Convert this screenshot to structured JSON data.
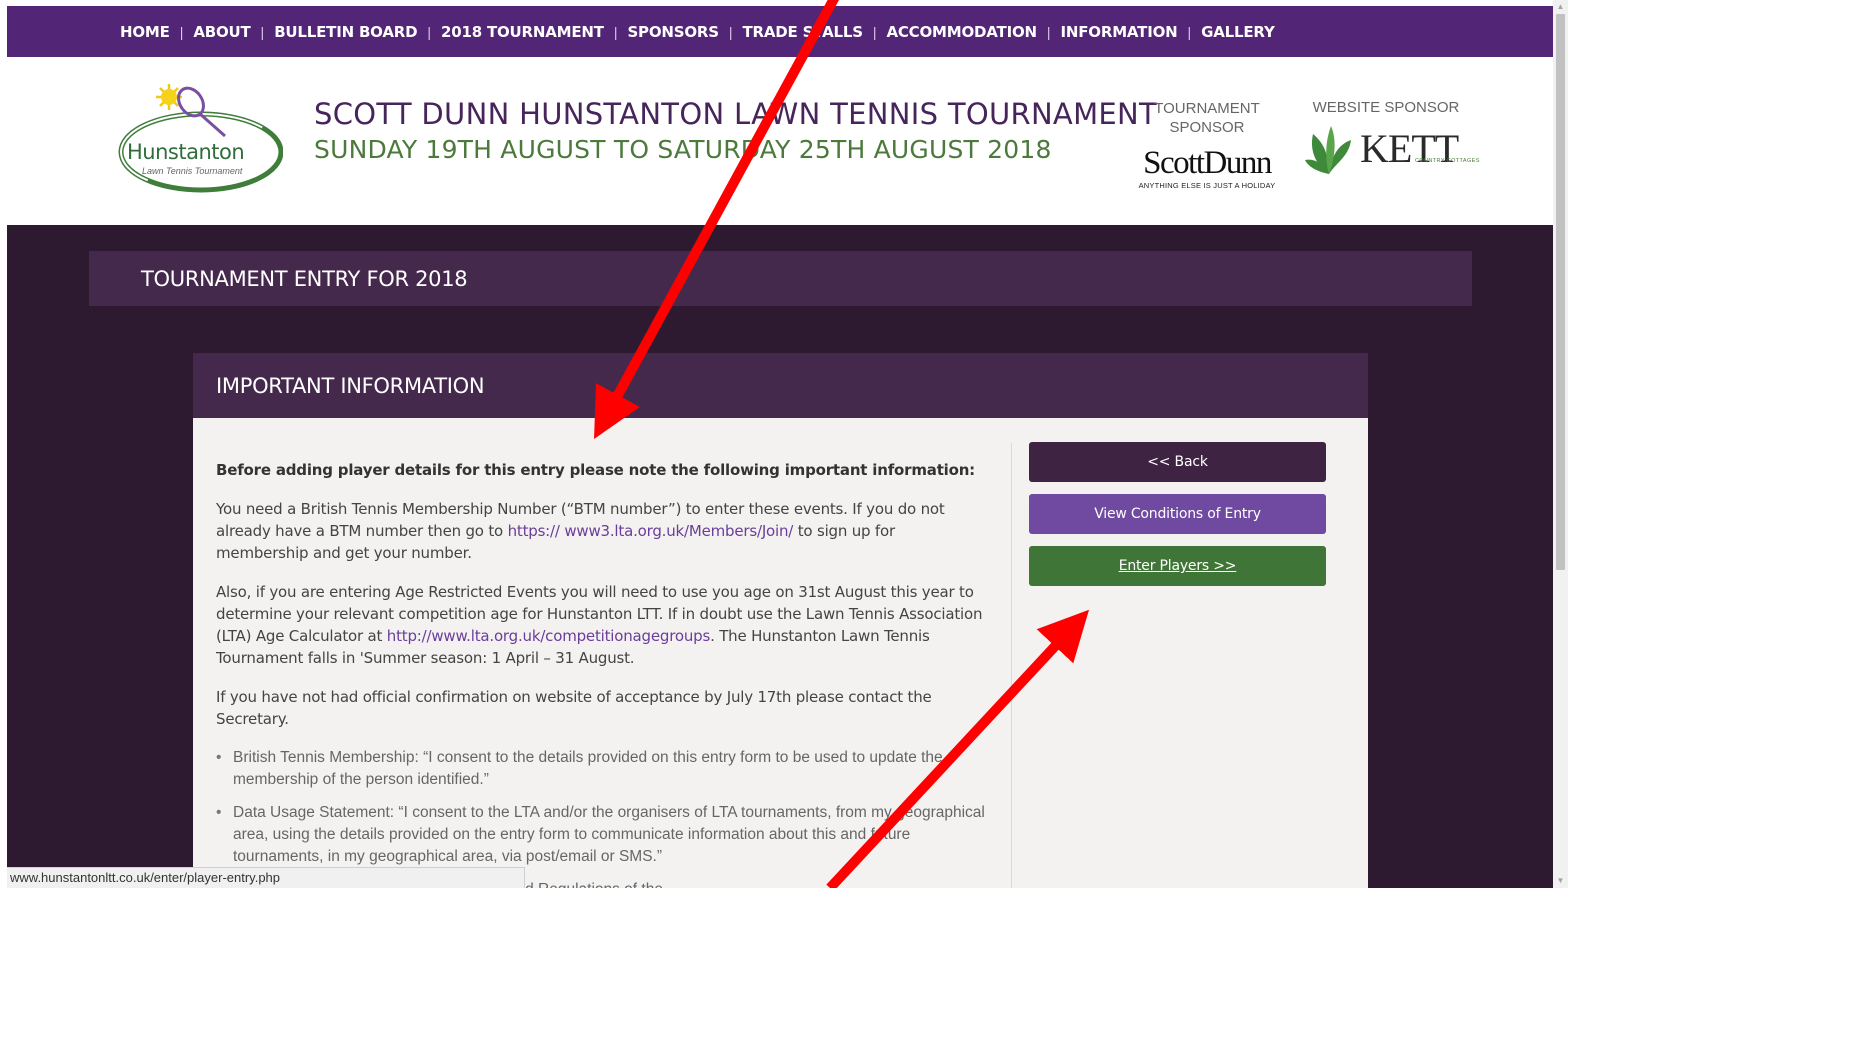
{
  "nav": {
    "items": [
      "HOME",
      "ABOUT",
      "BULLETIN BOARD",
      "2018 TOURNAMENT",
      "SPONSORS",
      "TRADE STALLS",
      "ACCOMMODATION",
      "INFORMATION",
      "GALLERY"
    ],
    "separator": "|"
  },
  "header": {
    "logo_word": "Hunstanton",
    "logo_sub": "Lawn Tennis Tournament",
    "title": "SCOTT DUNN HUNSTANTON LAWN TENNIS TOURNAMENT",
    "dates": "SUNDAY 19TH AUGUST TO SATURDAY 25TH AUGUST 2018",
    "tournament_sponsor_label": "TOURNAMENT SPONSOR",
    "tournament_sponsor_name": "ScottDunn",
    "tournament_sponsor_tagline": "ANYTHING ELSE IS JUST A HOLIDAY",
    "website_sponsor_label": "WEBSITE SPONSOR",
    "website_sponsor_name": "KETT",
    "website_sponsor_tagline": "COUNTRY COTTAGES"
  },
  "section": {
    "title": "TOURNAMENT ENTRY FOR 2018"
  },
  "panel": {
    "title": "IMPORTANT INFORMATION",
    "lead": "Before adding player details for this entry please note the following important information:",
    "p1_before": "You need a British Tennis Membership Number (“BTM number”) to enter these events. If you do not already have a BTM number then go to ",
    "p1_link": "https:// www3.lta.org.uk/Members/Join/",
    "p1_after": " to sign up for membership and get your number.",
    "p2_before": "Also, if you are entering Age Restricted Events you will need to use you age on 31st August this year to determine your relevant competition age for Hunstanton LTT. If in doubt use the Lawn Tennis Association (LTA) Age Calculator at ",
    "p2_link": "http://www.lta.org.uk/competitionagegroups",
    "p2_after": ". The Hunstanton Lawn Tennis Tournament falls in 'Summer season: 1 April – 31 August.",
    "p3": "If you have not had official confirmation on website of acceptance by July 17th please contact the Secretary.",
    "bullets": [
      "British Tennis Membership: “I consent to the details provided on this entry form to be used to update the membership of the person identified.”",
      "Data Usage Statement: “I consent to the LTA and/or the organisers of LTA tournaments, from my geographical area, using the details provided on the entry form to communicate information about this and future tournaments, in my geographical area, via post/email or SMS.”",
      "...d agree that I am subject to the Rules and Regulations of the"
    ],
    "buttons": {
      "back": "<< Back",
      "conditions": "View Conditions of Entry",
      "enter": "Enter Players >>"
    }
  },
  "status_url": "www.hunstantonltt.co.uk/enter/player-entry.php",
  "colors": {
    "nav_bg": "#522576",
    "page_bg": "#2d1a30",
    "bar_bg": "#45294d",
    "title_purple": "#46255a",
    "dates_green": "#4b7a3c",
    "btn_back": "#3e2343",
    "btn_conditions": "#7049a1",
    "btn_enter": "#3f7536",
    "annotation_arrow": "#ff0000"
  }
}
